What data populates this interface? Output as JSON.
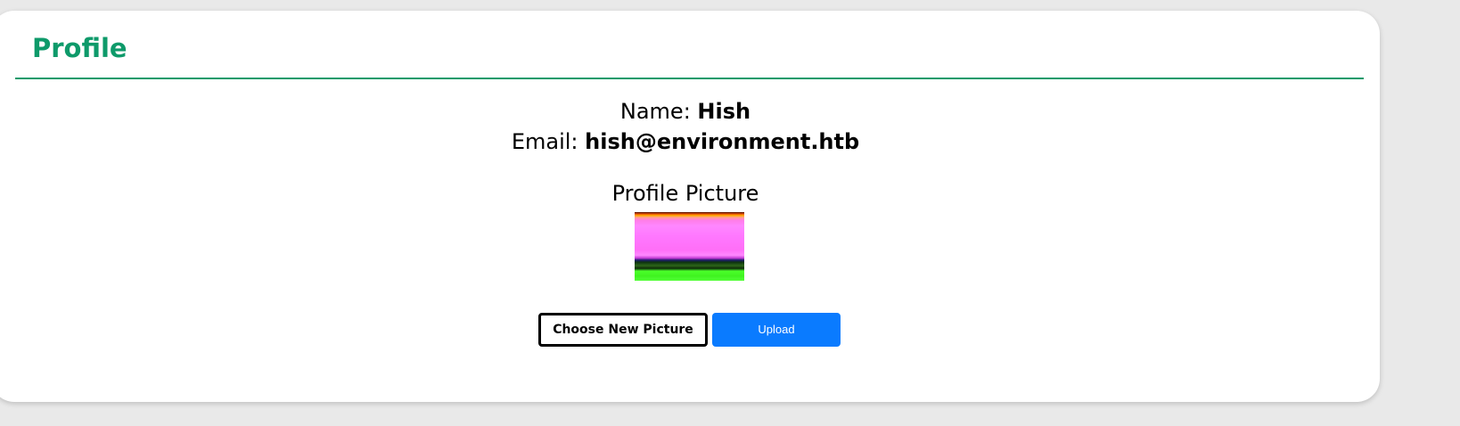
{
  "profile": {
    "title": "Profile",
    "name_label": "Name:",
    "name_value": "Hish",
    "email_label": "Email:",
    "email_value": "hish@environment.htb",
    "picture_heading": "Profile Picture"
  },
  "actions": {
    "choose_label": "Choose New Picture",
    "upload_label": "Upload"
  },
  "colors": {
    "accent": "#0e9a6a",
    "upload_button": "#0a7bff"
  }
}
